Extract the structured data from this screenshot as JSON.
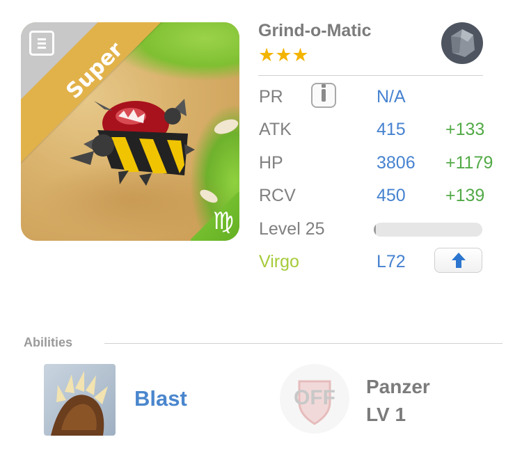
{
  "card": {
    "rarity_label": "Super",
    "zodiac_glyph": "♍",
    "icon": "document-icon"
  },
  "monster": {
    "name": "Grind-o-Matic",
    "stars": "★★★",
    "star_count": 3,
    "element_icon": "rock-element-icon"
  },
  "stats": {
    "pr": {
      "label": "PR",
      "value": "N/A"
    },
    "atk": {
      "label": "ATK",
      "value": "415",
      "bonus": "+133"
    },
    "hp": {
      "label": "HP",
      "value": "3806",
      "bonus": "+1179"
    },
    "rcv": {
      "label": "RCV",
      "value": "450",
      "bonus": "+139"
    },
    "level": {
      "label": "Level 25",
      "progress": 0.02
    },
    "zodiac": {
      "label": "Virgo",
      "value": "L72"
    }
  },
  "abilities": {
    "title": "Abilities",
    "primary": {
      "name": "Blast"
    },
    "secondary": {
      "toggle": "OFF",
      "name": "Panzer",
      "level": "LV 1"
    }
  },
  "colors": {
    "stat_value": "#4682d0",
    "stat_bonus": "#52aa47",
    "zodiac_label": "#a6cb3a",
    "star": "#f3b400",
    "ability_name": "#4a86cd"
  }
}
